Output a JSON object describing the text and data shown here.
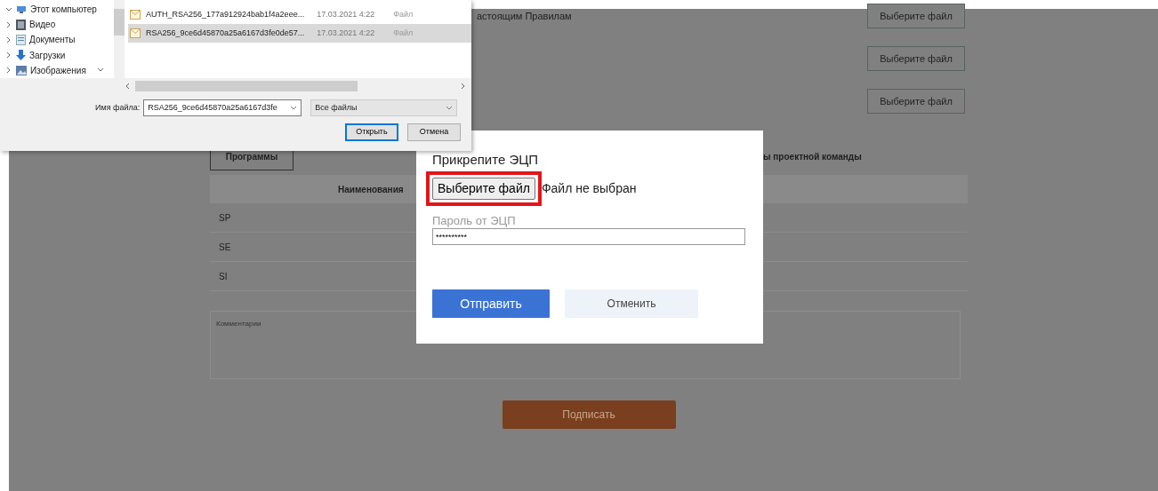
{
  "page": {
    "rules_text": "астоящим Правилам",
    "file_buttons": [
      "Выберите файл",
      "Выберите файл",
      "Выберите файл"
    ],
    "programs_tab": {
      "label": "Программы",
      "selected": true
    },
    "team_text": "ы проектной команды",
    "table": {
      "columns": [
        "Наименования"
      ],
      "rows": [
        [
          "SP"
        ],
        [
          "SE"
        ],
        [
          "SI"
        ]
      ]
    },
    "comment": {
      "placeholder": "Комментарии"
    },
    "sign_button": "Подписать"
  },
  "file_dialog": {
    "nav_items": [
      {
        "label": "Этот компьютер",
        "expanded": true
      },
      {
        "label": "Видео",
        "expanded": false
      },
      {
        "label": "Документы",
        "expanded": false
      },
      {
        "label": "Загрузки",
        "expanded": false
      },
      {
        "label": "Изображения",
        "expanded": false
      }
    ],
    "files": [
      {
        "name": "AUTH_RSA256_177a912924bab1f4a2eee...",
        "date": "17.03.2021 4:22",
        "type": "Файл",
        "selected": false
      },
      {
        "name": "RSA256_9ce6d45870a25a6167d3fe0de57...",
        "date": "17.03.2021 4:22",
        "type": "Файл",
        "selected": true
      }
    ],
    "filename_label": "Имя файла:",
    "filename": "RSA256_9ce6d45870a25a6167d3fe",
    "filter": "Все файлы",
    "open_button": "Открыть",
    "cancel_button": "Отмена"
  },
  "modal": {
    "title": "Прикрепите ЭЦП",
    "file_button": "Выберите файл",
    "highlighted": true,
    "file_status": "Файл не выбран",
    "password_label": "Пароль от ЭЦП",
    "password": "**********",
    "submit_button": "Отправить",
    "cancel_button": "Отменить"
  }
}
